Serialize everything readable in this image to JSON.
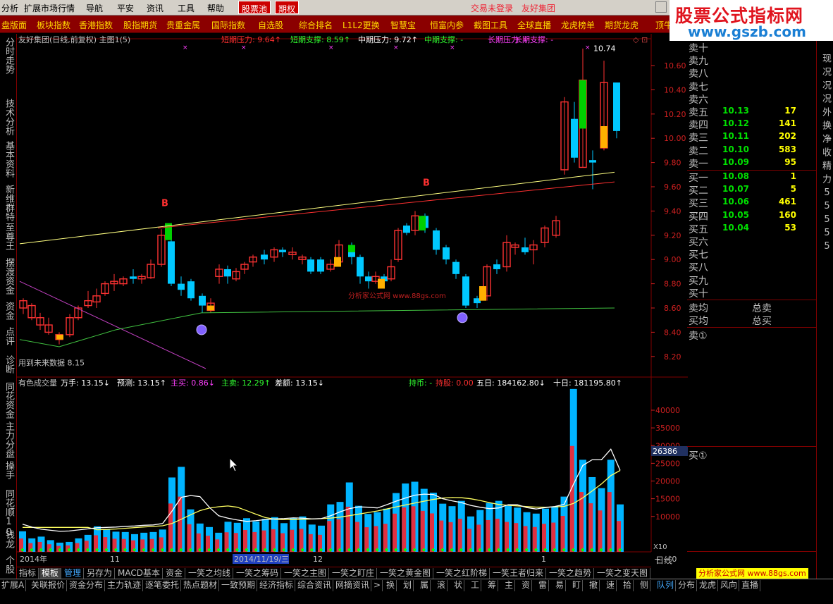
{
  "menu": {
    "items": [
      "分析",
      "扩展市场行情",
      "导航",
      "平安",
      "资讯",
      "工具",
      "帮助"
    ],
    "highlight": [
      "股票池",
      "期权"
    ],
    "status": [
      "交易未登录",
      "友好集团"
    ]
  },
  "brand": {
    "title": "股票公式指标网",
    "url": "www.gszb.com"
  },
  "index_toolbar": [
    "盘版面",
    "板块指数",
    "香港指数",
    "股指期货",
    "贵重金属",
    "国际指数",
    "自选股",
    "综合排名",
    "L1L2更换",
    "智慧宝",
    "恒富内参",
    "截图工具",
    "全球直播",
    "龙虎榜单",
    "期货龙虎",
    "顶牛"
  ],
  "left_tabs": [
    "分时走势",
    "技术分析",
    "基本资料",
    "新维群特",
    "至尊王",
    "摆渡资金",
    "资金",
    "点评",
    "诊断",
    "同花资金",
    "主力分盘",
    "操手",
    "同花顺10",
    "钱龙",
    "个股"
  ],
  "main_chart": {
    "header": {
      "title": "友好集团(日线,前复权) 主图1(5)",
      "items": [
        {
          "text": "短期压力: 9.64↑",
          "color": "#ff3030"
        },
        {
          "text": "短期支撑: 8.59↑",
          "color": "#30ff30"
        },
        {
          "text": "中期压力: 9.72↑",
          "color": "#ffffff"
        },
        {
          "text": "中期支撑: -",
          "color": "#30ff30"
        },
        {
          "text": "长期压力: -",
          "color": "#ff40ff"
        },
        {
          "text": "长期支撑: -",
          "color": "#ff40ff"
        }
      ]
    },
    "price_axis": [
      "10.60",
      "10.40",
      "10.20",
      "10.00",
      "9.80",
      "9.60",
      "9.40",
      "9.20",
      "9.00",
      "8.80",
      "8.60",
      "8.40",
      "8.20"
    ],
    "max_label": "10.74",
    "min_label": "用到未来数据 8.15",
    "b_signal": "B",
    "watermark": "分析家公式网 www.88gs.com"
  },
  "volume_chart": {
    "header": {
      "items": [
        {
          "text": "有色成交量",
          "color": "#c0c0c0"
        },
        {
          "text": "万手: 13.15↓",
          "color": "#ffffff"
        },
        {
          "text": "预测: 13.15↑",
          "color": "#ffffff"
        },
        {
          "text": "主买: 0.86↓",
          "color": "#ff40ff"
        },
        {
          "text": "主卖: 12.29↑",
          "color": "#30ff30"
        },
        {
          "text": "差额: 13.15↓",
          "color": "#ffffff"
        },
        {
          "text": "持币: -",
          "color": "#30ff30"
        },
        {
          "text": "持股: 0.00",
          "color": "#ff3030"
        },
        {
          "text": "五日: 184162.80↓",
          "color": "#ffffff"
        },
        {
          "text": "十日: 181195.80↑",
          "color": "#ffffff"
        }
      ]
    },
    "vol_axis": [
      "40000",
      "35000",
      "30000",
      "25000",
      "20000",
      "15000",
      "10000"
    ],
    "cursor_value": "26386",
    "multiplier": "X10",
    "dates": [
      "2014年",
      "11",
      "2014/11/19/三",
      "12",
      "1"
    ]
  },
  "order_book": {
    "sells": [
      {
        "label": "卖十",
        "price": "",
        "vol": ""
      },
      {
        "label": "卖九",
        "price": "",
        "vol": ""
      },
      {
        "label": "卖八",
        "price": "",
        "vol": ""
      },
      {
        "label": "卖七",
        "price": "",
        "vol": ""
      },
      {
        "label": "卖六",
        "price": "",
        "vol": ""
      },
      {
        "label": "卖五",
        "price": "10.13",
        "vol": "17"
      },
      {
        "label": "卖四",
        "price": "10.12",
        "vol": "141"
      },
      {
        "label": "卖三",
        "price": "10.11",
        "vol": "202"
      },
      {
        "label": "卖二",
        "price": "10.10",
        "vol": "583"
      },
      {
        "label": "卖一",
        "price": "10.09",
        "vol": "95"
      }
    ],
    "buys": [
      {
        "label": "买一",
        "price": "10.08",
        "vol": "1"
      },
      {
        "label": "买二",
        "price": "10.07",
        "vol": "5"
      },
      {
        "label": "买三",
        "price": "10.06",
        "vol": "461"
      },
      {
        "label": "买四",
        "price": "10.05",
        "vol": "160"
      },
      {
        "label": "买五",
        "price": "10.04",
        "vol": "53"
      },
      {
        "label": "买六",
        "price": "",
        "vol": ""
      },
      {
        "label": "买七",
        "price": "",
        "vol": ""
      },
      {
        "label": "买八",
        "price": "",
        "vol": ""
      },
      {
        "label": "买九",
        "price": "",
        "vol": ""
      },
      {
        "label": "买十",
        "price": "",
        "vol": ""
      }
    ],
    "summary": [
      {
        "left": "卖均",
        "right": "总卖"
      },
      {
        "left": "买均",
        "right": "总买"
      }
    ],
    "sell_queue": "卖①",
    "buy_queue": "买①",
    "period": "日线"
  },
  "right_tabs": [
    "现",
    "况",
    "况",
    "况",
    "外",
    "换",
    "净",
    "收",
    "精",
    "力",
    "5",
    "5",
    "5",
    "5",
    "5"
  ],
  "template_bar": [
    "指标",
    "模板",
    "管理",
    "另存为",
    "MACD基本",
    "资金",
    "一笑之均线",
    "一笑之筹码",
    "一笑之主图",
    "一笑之盯庄",
    "一笑之黄金图",
    "一笑之红阶梯",
    "一笑王者归来",
    "一笑之趋势",
    "一笑之变天图"
  ],
  "bottom_bar": [
    "扩展A",
    "关联报价",
    "资金分布",
    "主力轨迹",
    "逐笔委托",
    "热点题材",
    "一致预期",
    "经济指标",
    "综合资讯",
    "网摘资讯",
    ">",
    "换",
    "划",
    "属",
    "滚",
    "状",
    "工",
    "筹",
    "主",
    "资",
    "雷",
    "易",
    "盯",
    "撤",
    "速",
    "拾",
    "侧",
    "队列",
    "分布",
    "龙虎",
    "风向",
    "直播"
  ],
  "bottom_watermark": "分析家公式网 www.88gs.com",
  "colors": {
    "up": "#ff3232",
    "down": "#00c8ff",
    "accent": "#8b0000",
    "bg": "#000000"
  }
}
